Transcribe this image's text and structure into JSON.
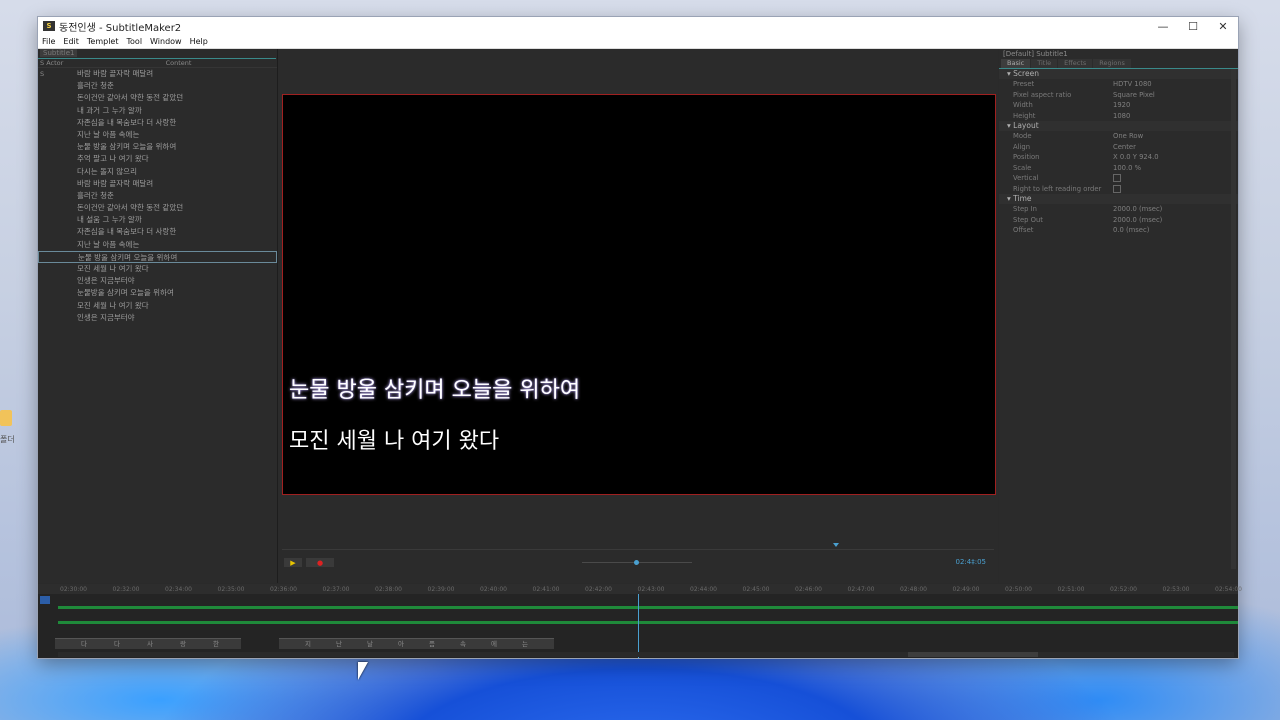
{
  "window": {
    "title": "동전인생 - SubtitleMaker2",
    "controls": [
      "—",
      "☐",
      "✕"
    ]
  },
  "menu": [
    "File",
    "Edit",
    "Templet",
    "Tool",
    "Window",
    "Help"
  ],
  "left_panel": {
    "tab": "Subtitle1",
    "columns": [
      "S  Actor",
      "Content"
    ],
    "first_row_num": "S",
    "rows": [
      "바람 바람 끝자락 매달려",
      "흘러간 청춘",
      "돈이건만 같아서 약한 동전 같았던",
      "내 과거 그 누가 알까",
      "자존심을 내 목숨보다 더 사랑한",
      "지난 날 아픔 속에는",
      "눈물 방울 삼키며 오늘을 위하여",
      "추억 팔고 나 여기 왔다",
      "다시는 돌지 않으리",
      "바람 바람 끝자락 매달려",
      "흘러간 청춘",
      "돈이건만 같아서 약한 동전 같았던",
      "내 설움 그 누가 알까",
      "자존심을 내 목숨보다 더 사랑한",
      "지난 날 아픔 속에는",
      "눈물 방울 삼키며 오늘을 위하여",
      "모진 세월 나 여기 왔다",
      "인생은 지금부터야",
      "눈물방울 삼키며 오늘을 위하여",
      "모진 세월 나 여기 왔다",
      "인생은 지금부터야"
    ],
    "selected_index": 15
  },
  "preview": {
    "caption_line1": "눈물 방울 삼키며 오늘을 위하여",
    "caption_line2": "모진 세월 나 여기 왔다",
    "time": "02:4‡:05"
  },
  "transport": {
    "play_icon": "▶",
    "record_icon": "●"
  },
  "right_panel": {
    "title": "[Default] Subtitle1",
    "tabs": [
      "Basic",
      "Title",
      "Effects",
      "Regions"
    ],
    "sections": {
      "screen": "Screen",
      "layout": "Layout",
      "time": "Time"
    },
    "screen": [
      {
        "k": "Preset",
        "v": "HDTV 1080"
      },
      {
        "k": "Pixel aspect ratio",
        "v": "Square Pixel"
      },
      {
        "k": "Width",
        "v": "1920"
      },
      {
        "k": "Height",
        "v": "1080"
      }
    ],
    "layout": [
      {
        "k": "Mode",
        "v": "One Row"
      },
      {
        "k": "Align",
        "v": "Center"
      },
      {
        "k": "Position",
        "v": "X 0.0          Y 924.0"
      },
      {
        "k": "Scale",
        "v": "100.0 %"
      },
      {
        "k": "Vertical",
        "v": ""
      },
      {
        "k": "Right to left reading order",
        "v": ""
      }
    ],
    "time": [
      {
        "k": "Step In",
        "v": "2000.0 (msec)"
      },
      {
        "k": "Step Out",
        "v": "2000.0 (msec)"
      },
      {
        "k": "Offset",
        "v": "0.0 (msec)"
      }
    ]
  },
  "timeline": {
    "ticks": [
      "02:30:00",
      "02:32:00",
      "02:34:00",
      "02:35:00",
      "02:36:00",
      "02:37:00",
      "02:38:00",
      "02:39:00",
      "02:40:00",
      "02:41:00",
      "02:42:00",
      "02:43:00",
      "02:44:00",
      "02:45:00",
      "02:46:00",
      "02:47:00",
      "02:48:00",
      "02:49:00",
      "02:50:00",
      "02:51:00",
      "02:52:00",
      "02:53:00",
      "02:54:00"
    ],
    "seg_a_chars": [
      "다",
      "다",
      "사",
      "랑",
      "한"
    ],
    "seg_b_chars": [
      "지",
      "난",
      "날",
      "아",
      "픔",
      "속",
      "에",
      "는"
    ]
  },
  "desktop": {
    "icon_label": "폴더"
  }
}
